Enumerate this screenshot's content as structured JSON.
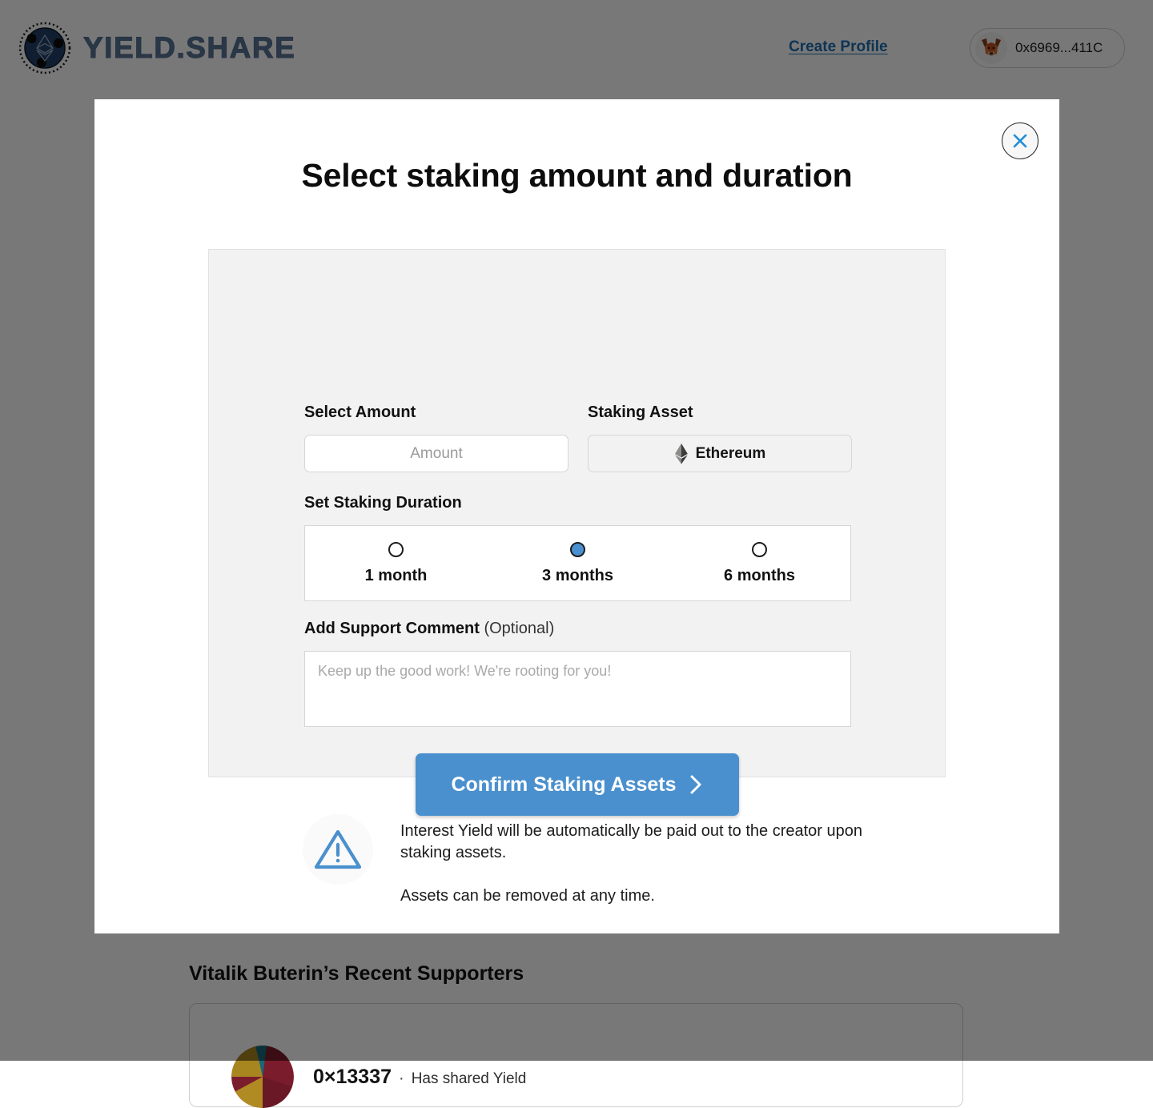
{
  "header": {
    "brand_name": "YIELD.SHARE",
    "brand_icon": "ethereum-network-logo",
    "create_profile_label": "Create Profile",
    "wallet": {
      "avatar_icon": "metamask-fox-icon",
      "address": "0x6969...411C"
    }
  },
  "modal": {
    "close_icon": "close-icon",
    "title": "Select staking amount and duration",
    "amount": {
      "label": "Select Amount",
      "placeholder": "Amount",
      "value": ""
    },
    "asset": {
      "label": "Staking Asset",
      "icon": "ethereum-icon",
      "selected": "Ethereum",
      "options": [
        "Ethereum"
      ]
    },
    "duration": {
      "label": "Set Staking Duration",
      "options": [
        {
          "label": "1 month",
          "selected": false
        },
        {
          "label": "3 months",
          "selected": true
        },
        {
          "label": "6 months",
          "selected": false
        }
      ]
    },
    "comment": {
      "label": "Add Support Comment",
      "label_suffix": "(Optional)",
      "placeholder": "Keep up the good work! We're rooting for you!",
      "value": ""
    },
    "confirm": {
      "label": "Confirm Staking Assets",
      "icon": "chevron-right-icon",
      "color": "#4a90ce"
    },
    "warning": {
      "icon": "warning-triangle-icon",
      "line1": "Interest Yield will be automatically be paid out to the creator upon staking assets.",
      "line2": "Assets can be removed at any time."
    }
  },
  "supporters": {
    "heading": "Vitalik Buterin’s Recent Supporters",
    "items": [
      {
        "avatar_icon": "identicon-avatar",
        "handle": "0×13337",
        "separator": "·",
        "status": "Has shared Yield"
      }
    ]
  },
  "colors": {
    "accent_blue": "#4a90ce",
    "link_blue": "#1f6fb2",
    "overlay": "rgba(0,0,0,0.53)"
  }
}
